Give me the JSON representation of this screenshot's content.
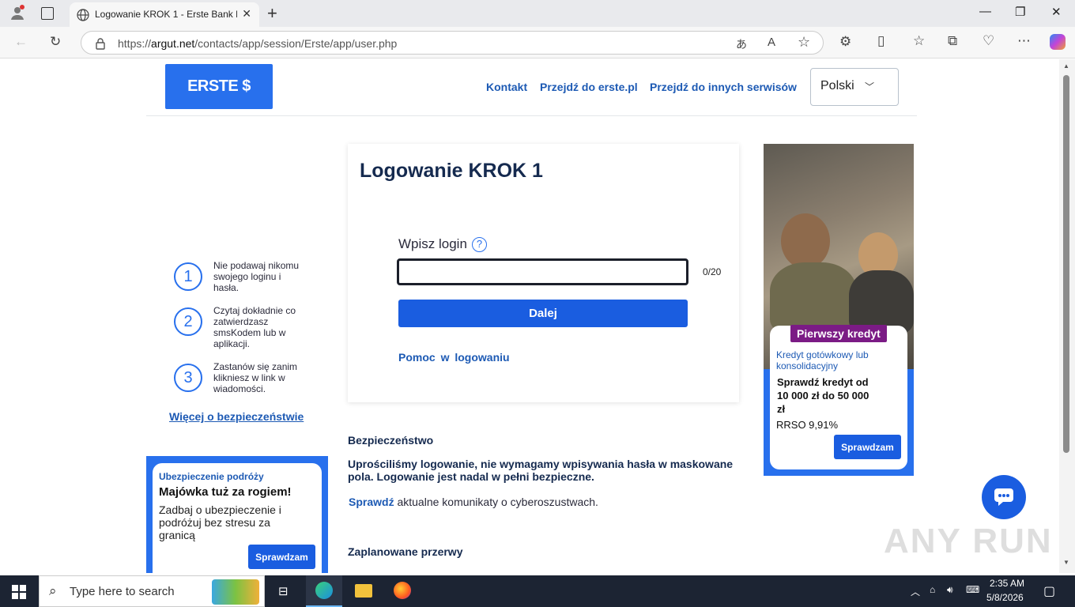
{
  "browser": {
    "tab_title": "Logowanie KROK 1 - Erste Bank P",
    "url_domain": "argut.net",
    "url_prefix": "https://",
    "url_path": "/contacts/app/session/Erste/app/user.php"
  },
  "header": {
    "logo_text": "ERSTE $",
    "links": [
      "Kontakt",
      "Przejdź do erste.pl",
      "Przejdź do innych serwisów"
    ],
    "language": "Polski"
  },
  "tips": [
    {
      "num": "1",
      "text": "Nie podawaj nikomu swojego loginu i hasła."
    },
    {
      "num": "2",
      "text": "Czytaj dokładnie co zatwierdzasz smsKodem lub w aplikacji."
    },
    {
      "num": "3",
      "text": "Zastanów się zanim klikniesz w link w wiadomości."
    }
  ],
  "more_security": "Więcej o bezpieczeństwie",
  "promo_left": {
    "kicker": "Ubezpieczenie podróży",
    "headline": "Majówka tuż za rogiem!",
    "desc": "Zadbaj o ubezpieczenie i podróżuj bez stresu za granicą",
    "button": "Sprawdzam"
  },
  "login": {
    "title": "Logowanie KROK 1",
    "label": "Wpisz login",
    "help_icon": "?",
    "input_value": "",
    "counter": "0/20",
    "next_button": "Dalej",
    "help_link": "Pomoc w logowaniu"
  },
  "security": {
    "heading": "Bezpieczeństwo",
    "body": "Uprościliśmy logowanie, nie wymagamy wpisywania hasła w maskowane pola. Logowanie jest nadal w pełni bezpieczne.",
    "check_link": "Sprawdź",
    "check_text": " aktualne komunikaty o cyberoszustwach."
  },
  "breaks_heading": "Zaplanowane przerwy",
  "promo_right": {
    "badge": "Pierwszy kredyt",
    "kicker": "Kredyt gotówkowy lub konsolidacyjny",
    "headline": "Sprawdź kredyt od 10 000 zł do 50 000 zł",
    "rrso": "RRSO 9,91%",
    "button": "Sprawdzam"
  },
  "watermark": "ANY RUN",
  "taskbar": {
    "search_placeholder": "Type here to search",
    "time": "2:35 AM",
    "date": "5/8/2026"
  },
  "colors": {
    "brand_blue": "#2870ed",
    "dark_navy": "#152a4f",
    "link_blue": "#1d5ab4",
    "badge_purple": "#7b1b85"
  }
}
